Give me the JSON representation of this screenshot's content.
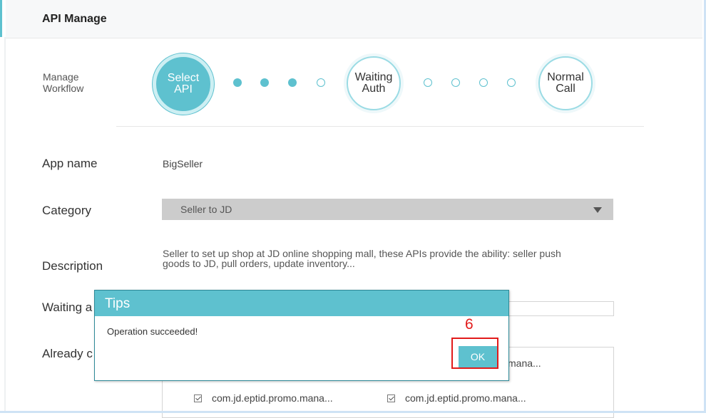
{
  "header": {
    "title": "API Manage"
  },
  "workflow": {
    "label_line1": "Manage",
    "label_line2": "Workflow",
    "steps": [
      {
        "line1": "Select",
        "line2": "API",
        "state": "active"
      },
      {
        "line1": "Waiting",
        "line2": "Auth",
        "state": "pending"
      },
      {
        "line1": "Normal",
        "line2": "Call",
        "state": "pending"
      }
    ],
    "dots_between_1_2": [
      "filled",
      "filled",
      "filled",
      "empty"
    ],
    "dots_between_2_3": [
      "empty",
      "empty",
      "empty",
      "empty"
    ]
  },
  "form": {
    "app_name_label": "App name",
    "app_name_value": "BigSeller",
    "category_label": "Category",
    "category_value": "Seller to JD",
    "description_label": "Description",
    "description_line1": "Seller to set up shop at JD online shopping mall, these APIs provide the ability: seller push",
    "description_line2": "goods to JD, pull orders, update inventory...",
    "waiting_label_visible": "Waiting a",
    "already_label_visible": "Already c",
    "api_items": [
      {
        "label": "com.jd.eptid.promo.mana...",
        "checked": true
      },
      {
        "label": "com.jd.eptid.promo.mana...",
        "checked": true
      }
    ],
    "partial_item_text": "mana..."
  },
  "dialog": {
    "title": "Tips",
    "message": "Operation succeeded!",
    "ok_label": "OK"
  },
  "annotation": {
    "number": "6",
    "color": "#e21b1b"
  },
  "colors": {
    "accent": "#5ec1cf",
    "select_bg": "#cccccc",
    "dialog_border": "#2f8a98"
  }
}
